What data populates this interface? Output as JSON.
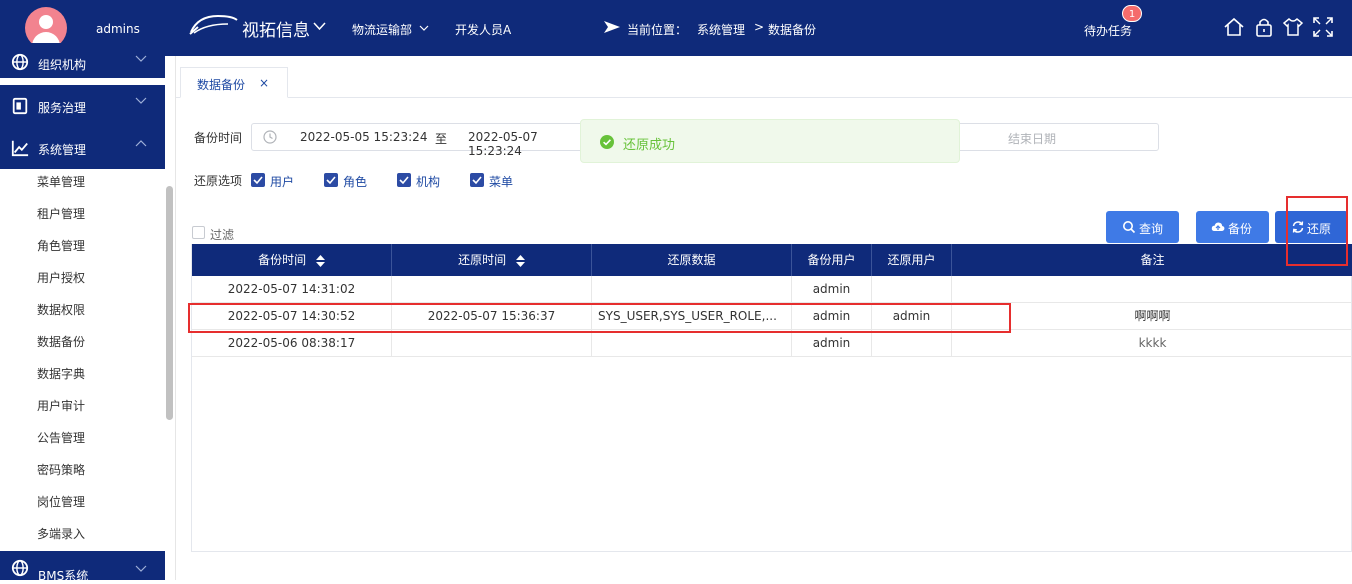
{
  "sidebar": {
    "username": "admins",
    "groups": [
      {
        "label": "组织机构",
        "icon": "globe-icon"
      },
      {
        "label": "服务治理",
        "icon": "service-icon"
      },
      {
        "label": "系统管理",
        "icon": "chart-line-icon"
      },
      {
        "label": "BMS系统",
        "icon": "globe-icon"
      }
    ],
    "items": [
      "菜单管理",
      "租户管理",
      "角色管理",
      "用户授权",
      "数据权限",
      "数据备份",
      "数据字典",
      "用户审计",
      "公告管理",
      "密码策略",
      "岗位管理",
      "多端录入"
    ]
  },
  "header": {
    "brand": "视拓信息",
    "dept": "物流运输部",
    "developer": "开发人员A",
    "location_label": "当前位置：",
    "breadcrumb": [
      "系统管理",
      "数据备份"
    ],
    "breadcrumb_sep": ">",
    "todo_label": "待办任务",
    "todo_count": "1",
    "icons": [
      "home-icon",
      "lock-icon",
      "theme-shirt-icon",
      "fullscreen-icon"
    ]
  },
  "tab": {
    "label": "数据备份",
    "close": "×"
  },
  "filters": {
    "backup_time_label": "备份时间",
    "start": "2022-05-05 15:23:24",
    "range_sep": "至",
    "end": "2022-05-07 15:23:24",
    "end_placeholder": "结束日期",
    "restore_options_label": "还原选项",
    "options": [
      {
        "label": "用户",
        "checked": true
      },
      {
        "label": "角色",
        "checked": true
      },
      {
        "label": "机构",
        "checked": true
      },
      {
        "label": "菜单",
        "checked": true
      }
    ],
    "filter_label": "过滤",
    "filter_checked": false
  },
  "toast": {
    "text": "还原成功",
    "type": "success",
    "color": "#67c23a"
  },
  "buttons": {
    "query": "查询",
    "backup": "备份",
    "restore": "还原"
  },
  "table": {
    "headers": [
      "备份时间",
      "还原时间",
      "还原数据",
      "备份用户",
      "还原用户",
      "备注"
    ],
    "rows": [
      [
        "2022-05-07 14:31:02",
        "",
        "",
        "admin",
        "",
        ""
      ],
      [
        "2022-05-07 14:30:52",
        "2022-05-07 15:36:37",
        "SYS_USER,SYS_USER_ROLE,...",
        "admin",
        "admin",
        "啊啊啊"
      ],
      [
        "2022-05-06 08:38:17",
        "",
        "",
        "admin",
        "",
        "kkkk"
      ]
    ]
  },
  "colors": {
    "primary_dark": "#0f2a7a",
    "button_blue": "#3f7ae6",
    "success_green": "#67c23a",
    "highlight_red": "#e62e2e"
  }
}
